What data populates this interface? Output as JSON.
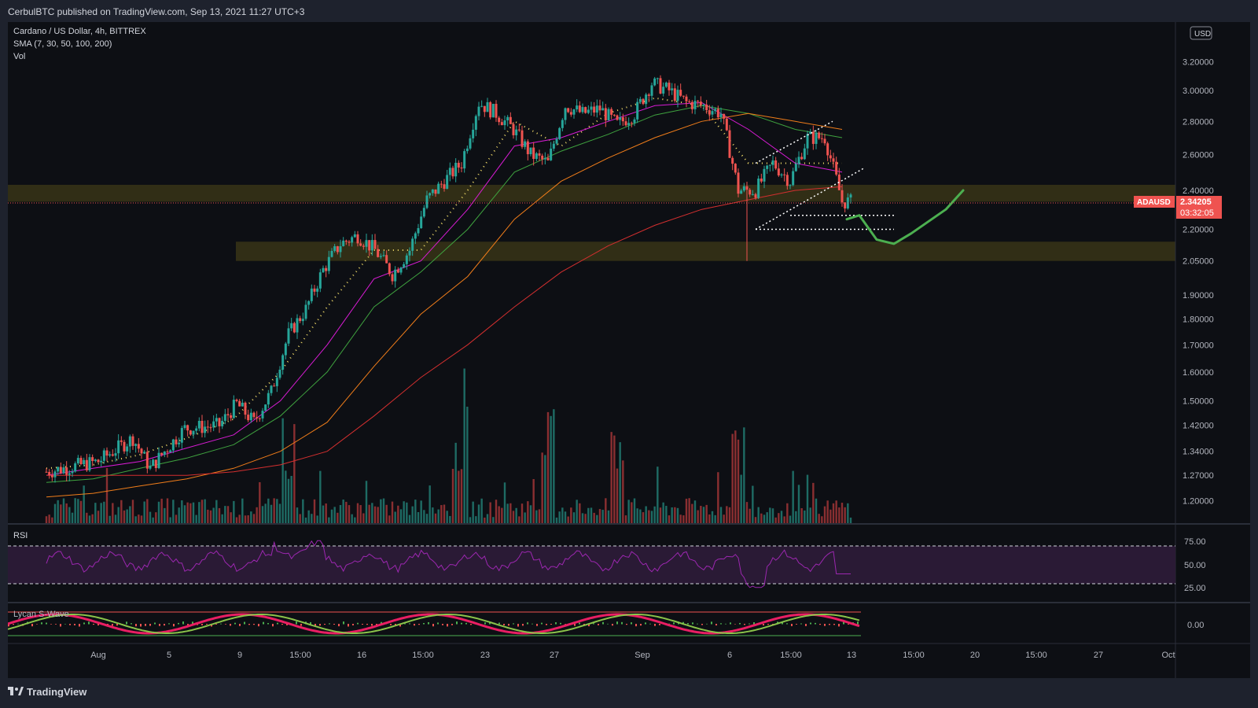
{
  "header": {
    "published_text": "CerbulBTC published on TradingView.com, Sep 13, 2021 11:27 UTC+3"
  },
  "legend": {
    "symbol_line": "Cardano / US Dollar, 4h, BITTREX",
    "sma_line": "SMA (7, 30, 50, 100, 200)",
    "vol_line": "Vol"
  },
  "price_axis": {
    "currency_button": "USD",
    "top_partial_label": "3.",
    "labels": [
      "3.20000",
      "3.00000",
      "2.80000",
      "2.60000",
      "2.40000",
      "2.20000",
      "2.05000",
      "1.90000",
      "1.80000",
      "1.70000",
      "1.60000",
      "1.50000",
      "1.42000",
      "1.34000",
      "1.27000",
      "1.20000"
    ],
    "last_price": "2.34205",
    "countdown": "03:32:05",
    "symbol_tag": "ADAUSD"
  },
  "rsi_pane": {
    "title": "RSI",
    "labels": [
      "75.00",
      "50.00",
      "25.00"
    ]
  },
  "wave_pane": {
    "title": "Lycan S-Wave",
    "labels": [
      "0.00"
    ]
  },
  "time_axis": {
    "labels": [
      "Aug",
      "5",
      "9",
      "15:00",
      "16",
      "15:00",
      "23",
      "27",
      "Sep",
      "6",
      "15:00",
      "13",
      "15:00",
      "20",
      "15:00",
      "27",
      "Oct"
    ]
  },
  "footer": {
    "brand": "TradingView"
  },
  "colors": {
    "background": "#0d0f14",
    "up": "#26a69a",
    "down": "#ef5350",
    "sma7": "#f7e16b",
    "sma30": "#d81bd4",
    "sma50": "#3fa33f",
    "sma100": "#f07d1a",
    "sma200": "#d32f2f",
    "zone": "#3d3a17",
    "projection": "#4caf50",
    "rsi": "#9c27b0",
    "last_price_tag": "#ef5350"
  },
  "chart_data": {
    "type": "candlestick",
    "symbol": "ADAUSD",
    "timeframe": "4h",
    "exchange": "BITTREX",
    "ylim": [
      1.15,
      3.3
    ],
    "y_scale": "log",
    "close_path": [
      [
        "Jul 29",
        1.28
      ],
      [
        "Jul 31",
        1.3
      ],
      [
        "Aug 1",
        1.31
      ],
      [
        "Aug 3",
        1.38
      ],
      [
        "Aug 4",
        1.29
      ],
      [
        "Aug 6",
        1.41
      ],
      [
        "Aug 8",
        1.42
      ],
      [
        "Aug 9",
        1.49
      ],
      [
        "Aug 10",
        1.43
      ],
      [
        "Aug 11",
        1.53
      ],
      [
        "Aug 12",
        1.74
      ],
      [
        "Aug 13",
        1.84
      ],
      [
        "Aug 14",
        2.01
      ],
      [
        "Aug 15",
        2.13
      ],
      [
        "Aug 16",
        2.17
      ],
      [
        "Aug 17",
        2.1
      ],
      [
        "Aug 18",
        1.99
      ],
      [
        "Aug 19",
        2.1
      ],
      [
        "Aug 20",
        2.35
      ],
      [
        "Aug 21",
        2.45
      ],
      [
        "Aug 22",
        2.55
      ],
      [
        "Aug 23",
        2.92
      ],
      [
        "Aug 24",
        2.85
      ],
      [
        "Aug 25",
        2.75
      ],
      [
        "Aug 26",
        2.6
      ],
      [
        "Aug 27",
        2.55
      ],
      [
        "Aug 28",
        2.9
      ],
      [
        "Aug 29",
        2.85
      ],
      [
        "Aug 30",
        2.88
      ],
      [
        "Aug 31",
        2.78
      ],
      [
        "Sep 1",
        2.85
      ],
      [
        "Sep 2",
        3.05
      ],
      [
        "Sep 3",
        3.0
      ],
      [
        "Sep 4",
        2.92
      ],
      [
        "Sep 5",
        2.9
      ],
      [
        "Sep 6",
        2.85
      ],
      [
        "Sep 7",
        2.4
      ],
      [
        "Sep 8",
        2.4
      ],
      [
        "Sep 9",
        2.55
      ],
      [
        "Sep 10",
        2.45
      ],
      [
        "Sep 11",
        2.7
      ],
      [
        "Sep 12",
        2.7
      ],
      [
        "Sep 13",
        2.34
      ]
    ],
    "sma_series": [
      {
        "name": "SMA 7",
        "values": [
          1.29,
          1.3,
          1.33,
          1.38,
          1.44,
          1.6,
          1.85,
          2.1,
          2.1,
          2.4,
          2.8,
          2.65,
          2.85,
          2.95,
          2.9,
          2.55,
          2.55,
          2.55
        ]
      },
      {
        "name": "SMA 30",
        "values": [
          1.27,
          1.29,
          1.31,
          1.35,
          1.39,
          1.5,
          1.7,
          1.97,
          2.05,
          2.3,
          2.65,
          2.7,
          2.8,
          2.9,
          2.92,
          2.75,
          2.55,
          2.5
        ]
      },
      {
        "name": "SMA 50",
        "values": [
          1.25,
          1.26,
          1.29,
          1.32,
          1.36,
          1.45,
          1.6,
          1.85,
          2.0,
          2.2,
          2.5,
          2.62,
          2.72,
          2.84,
          2.9,
          2.85,
          2.75,
          2.7
        ]
      },
      {
        "name": "SMA 100",
        "values": [
          1.21,
          1.22,
          1.24,
          1.26,
          1.29,
          1.34,
          1.43,
          1.62,
          1.82,
          1.98,
          2.25,
          2.45,
          2.58,
          2.7,
          2.8,
          2.85,
          2.8,
          2.75
        ]
      },
      {
        "name": "SMA 200",
        "values": [
          1.27,
          1.27,
          1.27,
          1.27,
          1.28,
          1.3,
          1.34,
          1.45,
          1.58,
          1.7,
          1.85,
          2.0,
          2.12,
          2.22,
          2.3,
          2.35,
          2.4,
          2.42
        ]
      }
    ],
    "zones": [
      {
        "name": "resistance-zone",
        "from": 2.34,
        "to": 2.43
      },
      {
        "name": "support-zone",
        "from": 2.05,
        "to": 2.14
      }
    ],
    "projection": [
      [
        "Sep 13",
        2.25
      ],
      [
        "Sep 14",
        2.27
      ],
      [
        "Sep 15",
        2.15
      ],
      [
        "Sep 16",
        2.13
      ],
      [
        "Sep 17",
        2.18
      ],
      [
        "Sep 19",
        2.3
      ],
      [
        "Sep 20",
        2.4
      ]
    ],
    "volume_spikes": [
      "Aug 12",
      "Aug 22",
      "Aug 27",
      "Aug 31",
      "Sep 7"
    ],
    "rsi": {
      "upper": 75,
      "mid": 50,
      "lower": 25,
      "last": 38
    }
  }
}
